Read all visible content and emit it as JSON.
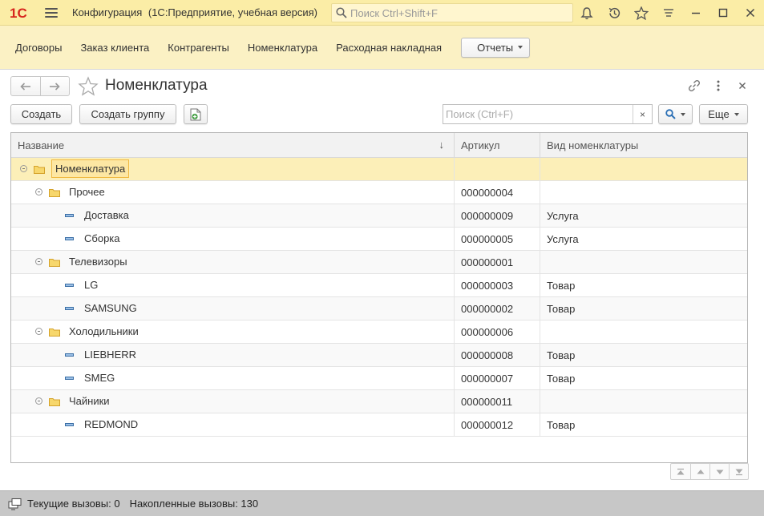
{
  "titlebar": {
    "logo": "1С",
    "title": "Конфигурация",
    "subtitle": "(1С:Предприятие, учебная версия)",
    "search_placeholder": "Поиск Ctrl+Shift+F",
    "icons": [
      "bell-icon",
      "history-icon",
      "star-icon",
      "menu-lines-icon",
      "minimize-icon",
      "maximize-icon",
      "close-icon"
    ]
  },
  "sections": {
    "items": [
      "Договоры",
      "Заказ клиента",
      "Контрагенты",
      "Номенклатура",
      "Расходная накладная"
    ],
    "reports_label": "Отчеты"
  },
  "form": {
    "title": "Номенклатура",
    "create_label": "Создать",
    "create_group_label": "Создать группу",
    "find_placeholder": "Поиск (Ctrl+F)",
    "clear_symbol": "×",
    "more_label": "Еще"
  },
  "table": {
    "columns": [
      "Название",
      "Артикул",
      "Вид номенклатуры"
    ],
    "sort_indicator": "↓",
    "rows": [
      {
        "level": 0,
        "type": "folder",
        "name": "Номенклатура",
        "code": "",
        "kind": ""
      },
      {
        "level": 1,
        "type": "folder",
        "name": "Прочее",
        "code": "000000004",
        "kind": ""
      },
      {
        "level": 2,
        "type": "item",
        "name": "Доставка",
        "code": "000000009",
        "kind": "Услуга"
      },
      {
        "level": 2,
        "type": "item",
        "name": "Сборка",
        "code": "000000005",
        "kind": "Услуга"
      },
      {
        "level": 1,
        "type": "folder",
        "name": "Телевизоры",
        "code": "000000001",
        "kind": ""
      },
      {
        "level": 2,
        "type": "item",
        "name": "LG",
        "code": "000000003",
        "kind": "Товар"
      },
      {
        "level": 2,
        "type": "item",
        "name": "SAMSUNG",
        "code": "000000002",
        "kind": "Товар"
      },
      {
        "level": 1,
        "type": "folder",
        "name": "Холодильники",
        "code": "000000006",
        "kind": ""
      },
      {
        "level": 2,
        "type": "item",
        "name": "LIEBHERR",
        "code": "000000008",
        "kind": "Товар"
      },
      {
        "level": 2,
        "type": "item",
        "name": "SMEG",
        "code": "000000007",
        "kind": "Товар"
      },
      {
        "level": 1,
        "type": "folder",
        "name": "Чайники",
        "code": "000000011",
        "kind": ""
      },
      {
        "level": 2,
        "type": "item",
        "name": "REDMOND",
        "code": "000000012",
        "kind": "Товар"
      }
    ]
  },
  "statusbar": {
    "current_calls": "Текущие вызовы: 0",
    "accumulated_calls": "Накопленные вызовы: 130"
  },
  "colors": {
    "titlebar_bg": "#fbeda6",
    "sections_bg": "#fbf1c4",
    "selected_row": "#fcefb8",
    "focus_border": "#f0b840",
    "logo_red": "#d7261e",
    "folder_yellow": "#f2c14e",
    "search_blue": "#2a6fb5",
    "status_bg": "#c7c7c7"
  }
}
